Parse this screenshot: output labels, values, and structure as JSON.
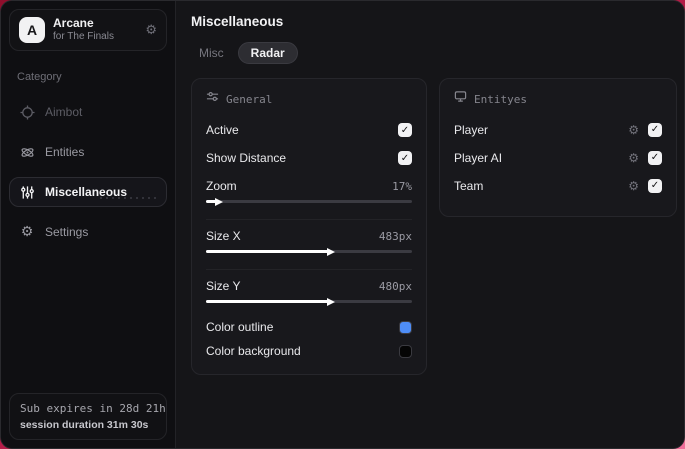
{
  "window": {
    "app_name": "Arcane",
    "app_subtitle": "for The Finals",
    "logo_letter": "A"
  },
  "icons": {
    "gear": "⚙",
    "check": "✓"
  },
  "sidebar": {
    "category_label": "Category",
    "items": [
      {
        "label": "Aimbot",
        "icon": "crosshair-icon",
        "active": false
      },
      {
        "label": "Entities",
        "icon": "atom-icon",
        "active": false
      },
      {
        "label": "Miscellaneous",
        "icon": "sliders-icon",
        "active": true
      },
      {
        "label": "Settings",
        "icon": "gear-icon",
        "active": false
      }
    ],
    "status": {
      "line1": "Sub expires in 28d 21h",
      "line2": "session duration 31m 30s"
    }
  },
  "main": {
    "title": "Miscellaneous",
    "tabs": [
      {
        "label": "Misc",
        "active": false
      },
      {
        "label": "Radar",
        "active": true
      }
    ],
    "general": {
      "title": "General",
      "toggles": [
        {
          "label": "Active",
          "checked": true
        },
        {
          "label": "Show Distance",
          "checked": true
        }
      ],
      "sliders": [
        {
          "label": "Zoom",
          "value": "17%",
          "percent": 6
        },
        {
          "label": "Size X",
          "value": "483px",
          "percent": 60
        },
        {
          "label": "Size Y",
          "value": "480px",
          "percent": 60
        }
      ],
      "colors": [
        {
          "label": "Color outline",
          "swatch": "#4e8df6"
        },
        {
          "label": "Color background",
          "swatch": "#050505"
        }
      ]
    },
    "entities": {
      "title": "Entityes",
      "items": [
        {
          "label": "Player",
          "checked": true
        },
        {
          "label": "Player AI",
          "checked": true
        },
        {
          "label": "Team",
          "checked": true
        }
      ]
    }
  },
  "theme": {
    "accent_blue": "#4e8df6",
    "backdrop_red": "#8f0e2c"
  }
}
